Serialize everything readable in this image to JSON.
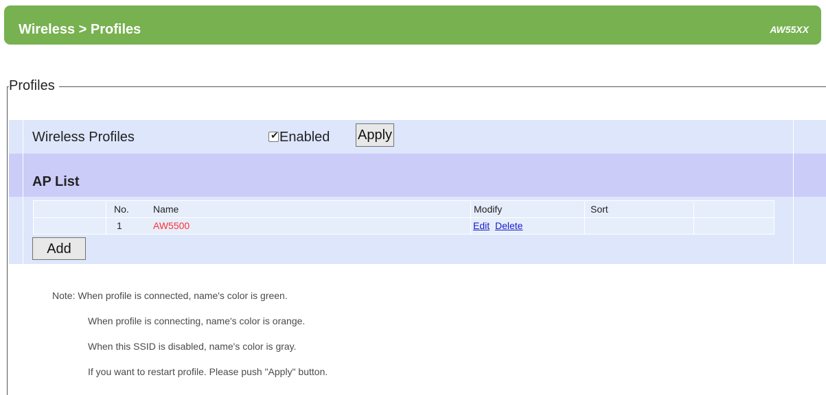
{
  "header": {
    "title": "Wireless > Profiles",
    "model": "AW55XX",
    "color": "#77b150"
  },
  "section": {
    "legend": "Profiles"
  },
  "wireless_profiles": {
    "label": "Wireless Profiles",
    "checkbox_checked": true,
    "enabled_label": "Enabled",
    "apply_label": "Apply"
  },
  "ap_list": {
    "title": "AP List",
    "columns": {
      "no": "No.",
      "name": "Name",
      "modify": "Modify",
      "sort": "Sort"
    },
    "rows": [
      {
        "no": "1",
        "name": "AW5500",
        "name_color": "#ff3030",
        "edit": "Edit",
        "delete": "Delete"
      }
    ],
    "add_label": "Add"
  },
  "notes": [
    "Note: When profile is connected, name's color is green.",
    "When profile is connecting, name's color is orange.",
    "When this SSID is disabled, name's color is gray.",
    "If you want to restart profile. Please push \"Apply\" button."
  ]
}
